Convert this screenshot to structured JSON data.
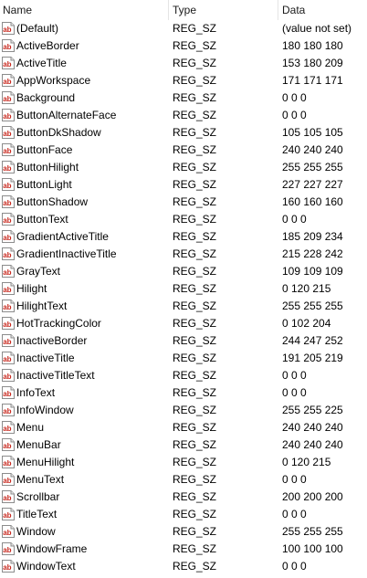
{
  "columns": {
    "name": "Name",
    "type": "Type",
    "data": "Data"
  },
  "icon": "string-value-ab-icon",
  "rows": [
    {
      "name": "(Default)",
      "type": "REG_SZ",
      "data": "(value not set)"
    },
    {
      "name": "ActiveBorder",
      "type": "REG_SZ",
      "data": "180 180 180"
    },
    {
      "name": "ActiveTitle",
      "type": "REG_SZ",
      "data": "153 180 209"
    },
    {
      "name": "AppWorkspace",
      "type": "REG_SZ",
      "data": "171 171 171"
    },
    {
      "name": "Background",
      "type": "REG_SZ",
      "data": "0 0 0"
    },
    {
      "name": "ButtonAlternateFace",
      "type": "REG_SZ",
      "data": "0 0 0"
    },
    {
      "name": "ButtonDkShadow",
      "type": "REG_SZ",
      "data": "105 105 105"
    },
    {
      "name": "ButtonFace",
      "type": "REG_SZ",
      "data": "240 240 240"
    },
    {
      "name": "ButtonHilight",
      "type": "REG_SZ",
      "data": "255 255 255"
    },
    {
      "name": "ButtonLight",
      "type": "REG_SZ",
      "data": "227 227 227"
    },
    {
      "name": "ButtonShadow",
      "type": "REG_SZ",
      "data": "160 160 160"
    },
    {
      "name": "ButtonText",
      "type": "REG_SZ",
      "data": "0 0 0"
    },
    {
      "name": "GradientActiveTitle",
      "type": "REG_SZ",
      "data": "185 209 234"
    },
    {
      "name": "GradientInactiveTitle",
      "type": "REG_SZ",
      "data": "215 228 242"
    },
    {
      "name": "GrayText",
      "type": "REG_SZ",
      "data": "109 109 109"
    },
    {
      "name": "Hilight",
      "type": "REG_SZ",
      "data": "0 120 215"
    },
    {
      "name": "HilightText",
      "type": "REG_SZ",
      "data": "255 255 255"
    },
    {
      "name": "HotTrackingColor",
      "type": "REG_SZ",
      "data": "0 102 204"
    },
    {
      "name": "InactiveBorder",
      "type": "REG_SZ",
      "data": "244 247 252"
    },
    {
      "name": "InactiveTitle",
      "type": "REG_SZ",
      "data": "191 205 219"
    },
    {
      "name": "InactiveTitleText",
      "type": "REG_SZ",
      "data": "0 0 0"
    },
    {
      "name": "InfoText",
      "type": "REG_SZ",
      "data": "0 0 0"
    },
    {
      "name": "InfoWindow",
      "type": "REG_SZ",
      "data": "255 255 225"
    },
    {
      "name": "Menu",
      "type": "REG_SZ",
      "data": "240 240 240"
    },
    {
      "name": "MenuBar",
      "type": "REG_SZ",
      "data": "240 240 240"
    },
    {
      "name": "MenuHilight",
      "type": "REG_SZ",
      "data": "0 120 215"
    },
    {
      "name": "MenuText",
      "type": "REG_SZ",
      "data": "0 0 0"
    },
    {
      "name": "Scrollbar",
      "type": "REG_SZ",
      "data": "200 200 200"
    },
    {
      "name": "TitleText",
      "type": "REG_SZ",
      "data": "0 0 0"
    },
    {
      "name": "Window",
      "type": "REG_SZ",
      "data": "255 255 255"
    },
    {
      "name": "WindowFrame",
      "type": "REG_SZ",
      "data": "100 100 100"
    },
    {
      "name": "WindowText",
      "type": "REG_SZ",
      "data": "0 0 0"
    }
  ]
}
